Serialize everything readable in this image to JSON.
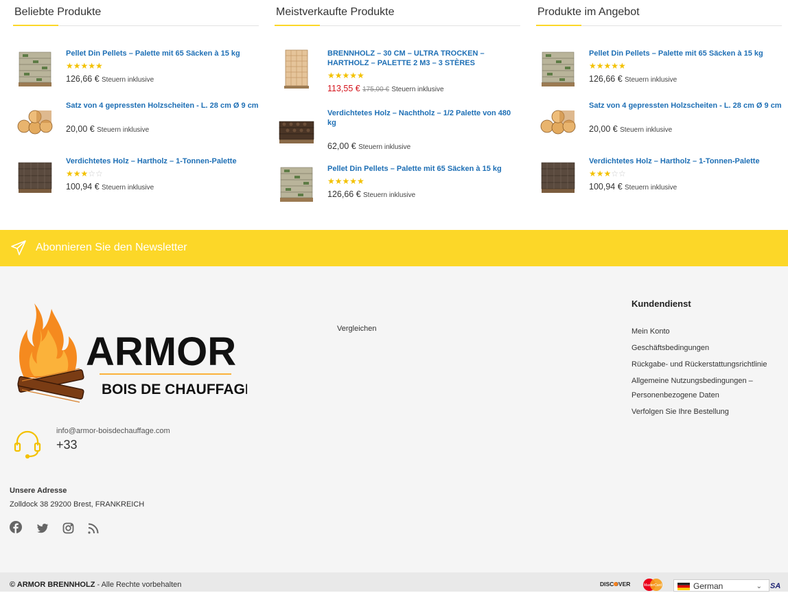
{
  "widgets": [
    {
      "title": "Beliebte Produkte",
      "items": [
        {
          "title": "Pellet Din Pellets – Palette mit 65 Säcken à 15 kg",
          "rating": 5,
          "price": "126,66 €",
          "tax": "Steuern inklusive",
          "thumb": "pellet-pallet"
        },
        {
          "title": "Satz von 4 gepressten Holzscheiten - L. 28 cm Ø 9 cm",
          "rating": 0,
          "price": "20,00 €",
          "tax": "Steuern inklusive",
          "thumb": "logs"
        },
        {
          "title": "Verdichtetes Holz – Hartholz – 1-Tonnen-Palette",
          "rating": 3,
          "price": "100,94 €",
          "tax": "Steuern inklusive",
          "thumb": "briquette-pallet"
        }
      ]
    },
    {
      "title": "Meistverkaufte Produkte",
      "items": [
        {
          "title": "BRENNHOLZ – 30 CM – ULTRA TROCKEN – HARTHOLZ – PALETTE 2 M3 – 3 STÈRES",
          "rating": 5,
          "sale_price": "113,55 €",
          "old_price": "175,00 €",
          "tax": "Steuern inklusive",
          "thumb": "firewood-crate"
        },
        {
          "title": "Verdichtetes Holz – Nachtholz – 1/2 Palette von 480 kg",
          "rating": 0,
          "price": "62,00 €",
          "tax": "Steuern inklusive",
          "thumb": "dark-briquette-pallet"
        },
        {
          "title": "Pellet Din Pellets – Palette mit 65 Säcken à 15 kg",
          "rating": 5,
          "price": "126,66 €",
          "tax": "Steuern inklusive",
          "thumb": "pellet-pallet"
        }
      ]
    },
    {
      "title": "Produkte im Angebot",
      "items": [
        {
          "title": "Pellet Din Pellets – Palette mit 65 Säcken à 15 kg",
          "rating": 5,
          "price": "126,66 €",
          "tax": "Steuern inklusive",
          "thumb": "pellet-pallet"
        },
        {
          "title": "Satz von 4 gepressten Holzscheiten - L. 28 cm Ø 9 cm",
          "rating": 0,
          "price": "20,00 €",
          "tax": "Steuern inklusive",
          "thumb": "logs"
        },
        {
          "title": "Verdichtetes Holz – Hartholz – 1-Tonnen-Palette",
          "rating": 3,
          "price": "100,94 €",
          "tax": "Steuern inklusive",
          "thumb": "briquette-pallet"
        }
      ]
    }
  ],
  "newsletter": {
    "label": "Abonnieren Sie den Newsletter",
    "icon": "paper-plane-icon"
  },
  "footer": {
    "logo": {
      "name": "ARMOR",
      "tagline": "BOIS DE CHAUFFAGE"
    },
    "email": "info@armor-boisdechauffage.com",
    "phone": "+33",
    "address_title": "Unsere Adresse",
    "address": "Zolldock 38 29200 Brest, FRANKREICH",
    "socials": [
      "facebook-icon",
      "twitter-icon",
      "instagram-icon",
      "rss-icon"
    ],
    "compare": "Vergleichen",
    "service_title": "Kundendienst",
    "service_links": [
      "Mein Konto",
      "Geschäftsbedingungen",
      "Rückgabe- und Rückerstattungsrichtlinie",
      "Allgemeine Nutzungsbedingungen – Personenbezogene Daten",
      "Verfolgen Sie Ihre Bestellung"
    ]
  },
  "bottom": {
    "brand": "© ARMOR BRENNHOLZ",
    "rights": " - Alle Rechte vorbehalten",
    "payments": [
      "DISCOVER",
      "MasterCard",
      "VISA"
    ],
    "language": "German"
  },
  "colors": {
    "accent": "#fcd728",
    "link": "#1e6fb5",
    "sale": "#d4141c",
    "star": "#f3c100"
  }
}
